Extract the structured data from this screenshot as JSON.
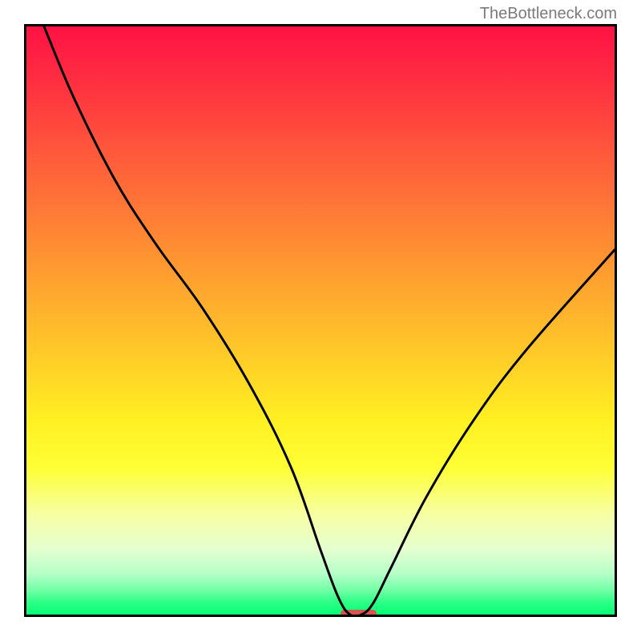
{
  "attribution": "TheBottleneck.com",
  "chart_data": {
    "type": "line",
    "title": "",
    "xlabel": "",
    "ylabel": "",
    "xlim": [
      0,
      100
    ],
    "ylim": [
      0,
      100
    ],
    "grid": false,
    "legend": false,
    "series": [
      {
        "name": "bottleneck-curve",
        "x": [
          3,
          8,
          15,
          22,
          30,
          38,
          45,
          50,
          53,
          55,
          57,
          59,
          62,
          68,
          76,
          85,
          100
        ],
        "values": [
          100,
          88,
          74,
          63,
          52,
          39,
          25,
          11,
          3,
          0,
          0,
          2,
          8,
          20,
          33,
          45,
          62
        ]
      }
    ],
    "marker": {
      "x_center": 56,
      "y": 0,
      "width_pct": 6,
      "height_pct": 1.2,
      "color": "#d9534f"
    },
    "background_gradient": {
      "top": "#ff1243",
      "bottom": "#08ff77",
      "stops": [
        "red",
        "orange",
        "yellow",
        "light-yellow",
        "green"
      ]
    }
  }
}
